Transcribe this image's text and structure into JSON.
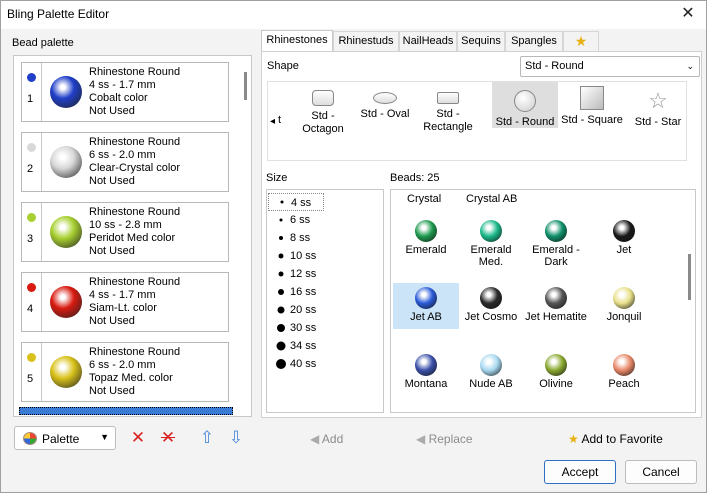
{
  "window": {
    "title": "Bling Palette Editor",
    "close": "✕"
  },
  "left": {
    "header": "Bead palette",
    "items": [
      {
        "num": "1",
        "name": "Rhinestone Round",
        "size": "4 ss - 1.7 mm",
        "color": "Cobalt color",
        "status": "Not Used",
        "swatch": "#1f3fc8"
      },
      {
        "num": "2",
        "name": "Rhinestone Round",
        "size": "6 ss - 2.0 mm",
        "color": "Clear-Crystal color",
        "status": "Not Used",
        "swatch": "#d8d8d8"
      },
      {
        "num": "3",
        "name": "Rhinestone Round",
        "size": "10 ss - 2.8 mm",
        "color": "Peridot Med color",
        "status": "Not Used",
        "swatch": "#a8d030"
      },
      {
        "num": "4",
        "name": "Rhinestone Round",
        "size": "4 ss - 1.7 mm",
        "color": "Siam-Lt. color",
        "status": "Not Used",
        "swatch": "#d81a10"
      },
      {
        "num": "5",
        "name": "Rhinestone Round",
        "size": "6 ss - 2.0 mm",
        "color": "Topaz Med. color",
        "status": "Not Used",
        "swatch": "#d9c21a"
      }
    ],
    "palette_dropdown": "Palette",
    "delete_icon": "✕",
    "delete_all_icon": "✕",
    "up_icon": "⇧",
    "down_icon": "⇩"
  },
  "tabs": [
    "Rhinestones",
    "Rhinestuds",
    "NailHeads",
    "Sequins",
    "Spangles",
    "★"
  ],
  "shape": {
    "label": "Shape",
    "selected": "Std - Round",
    "items": [
      {
        "label": "Std -\nOctagon",
        "icon": "octagon-icon"
      },
      {
        "label": "Std - Oval",
        "icon": "oval-icon"
      },
      {
        "label": "Std -\nRectangle",
        "icon": "rectangle-icon"
      },
      {
        "label": "Std - Round",
        "icon": "round-icon"
      },
      {
        "label": "Std - Square",
        "icon": "square-icon"
      },
      {
        "label": "Std - Star",
        "icon": "star-icon"
      }
    ],
    "partial_left": "t",
    "left_arrow": "◂",
    "right_arrow": "▸"
  },
  "size": {
    "label": "Size",
    "items": [
      "4 ss",
      "6 ss",
      "8 ss",
      "10 ss",
      "12 ss",
      "16 ss",
      "20 ss",
      "30 ss",
      "34 ss",
      "40 ss"
    ],
    "selected": "4 ss"
  },
  "beads": {
    "label": "Beads: 25",
    "head_crystal": "Crystal",
    "head_crystal_ab": "Crystal AB",
    "items": [
      {
        "name": "Emerald",
        "color": "#1e9a4e"
      },
      {
        "name": "Emerald Med.",
        "color": "#1ab88a"
      },
      {
        "name": "Emerald - Dark",
        "color": "#0f8f6a"
      },
      {
        "name": "Jet",
        "color": "#1a1a1a"
      },
      {
        "name": "Jet AB",
        "color": "#2a5bd8"
      },
      {
        "name": "Jet Cosmo",
        "color": "#2a2a2a"
      },
      {
        "name": "Jet Hematite",
        "color": "#555555"
      },
      {
        "name": "Jonquil",
        "color": "#e8e08a"
      },
      {
        "name": "Montana",
        "color": "#3a50a8"
      },
      {
        "name": "Nude AB",
        "color": "#a8d8f0"
      },
      {
        "name": "Olivine",
        "color": "#8aa830"
      },
      {
        "name": "Peach",
        "color": "#e88868"
      }
    ]
  },
  "actions": {
    "add": "Add",
    "replace": "Replace",
    "favorite": "Add to Favorite"
  },
  "buttons": {
    "accept": "Accept",
    "cancel": "Cancel"
  }
}
